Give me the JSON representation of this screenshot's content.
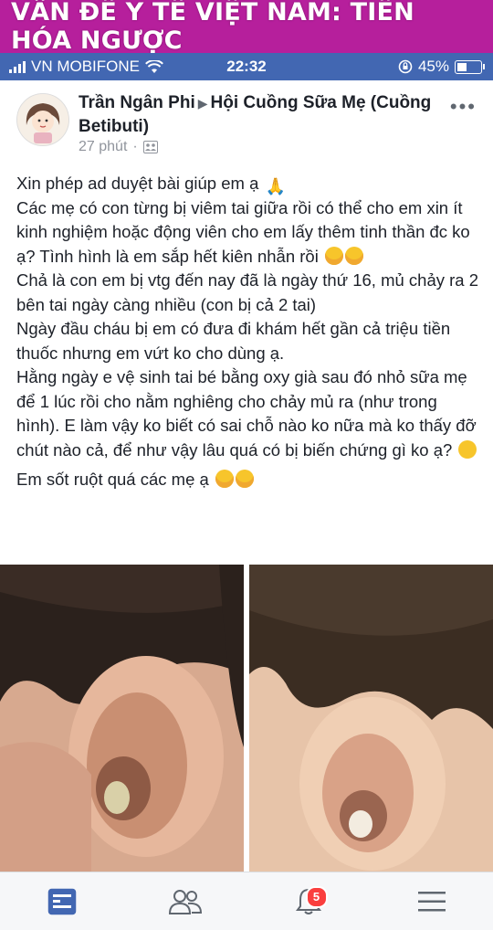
{
  "banner": {
    "text": "VẤN ĐỀ Y TẾ VIỆT NAM: TIẾN HÓA NGƯỢC"
  },
  "status_bar": {
    "carrier": "VN MOBIFONE",
    "time": "22:32",
    "battery": "45%",
    "battery_level": 0.45
  },
  "post": {
    "author": "Trần Ngân Phi",
    "group": "Hội Cuồng Sữa Mẹ (Cuồng Betibuti)",
    "time": "27 phút",
    "more_label": "•••",
    "paragraphs": [
      "Xin phép ad duyệt bài giúp em ạ",
      "Các mẹ có con từng bị viêm tai giữa rồi có thể cho em xin ít kinh nghiệm hoặc động viên cho em lấy thêm tinh thần đc ko ạ? Tình hình là em sắp hết kiên nhẫn rồi",
      "Chả là con em bị vtg đến nay đã là ngày thứ 16, mủ chảy ra 2 bên tai ngày càng nhiều (con bị cả 2 tai)",
      "Ngày đầu cháu bị em có đưa đi khám hết gần cả triệu tiền thuốc nhưng em vứt ko cho dùng ạ.",
      "Hằng ngày e vệ sinh tai bé bằng oxy già sau đó nhỏ sữa mẹ để 1 lúc rồi cho nằm nghiêng cho chảy mủ ra (như trong hình). E làm vậy ko biết có sai chỗ nào ko nữa mà ko thấy đỡ chút nào cả, để như vậy lâu quá có bị biến chứng gì ko ạ?",
      "Em sốt ruột quá các mẹ ạ"
    ]
  },
  "tabbar": {
    "notification_count": "5"
  },
  "colors": {
    "facebook_blue": "#4267b2",
    "banner_magenta": "#b61f9c",
    "badge_red": "#fa3e3e"
  }
}
